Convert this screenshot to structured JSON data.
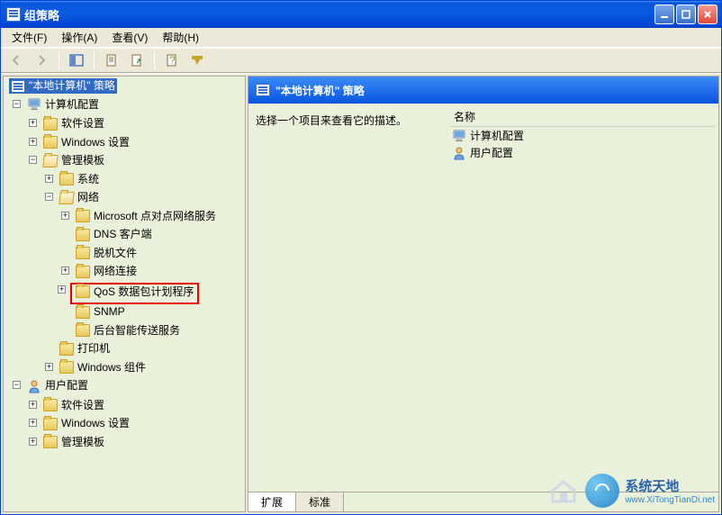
{
  "window": {
    "title": "组策略"
  },
  "menu": {
    "file": "文件(F)",
    "action": "操作(A)",
    "view": "查看(V)",
    "help": "帮助(H)"
  },
  "tree": {
    "root": "\"本地计算机\" 策略",
    "computer_config": "计算机配置",
    "software_settings": "软件设置",
    "windows_settings": "Windows 设置",
    "admin_templates": "管理模板",
    "system": "系统",
    "network": "网络",
    "ms_p2p": "Microsoft 点对点网络服务",
    "dns_client": "DNS 客户端",
    "offline_files": "脱机文件",
    "network_connections": "网络连接",
    "qos": "QoS 数据包计划程序",
    "snmp": "SNMP",
    "bits": "后台智能传送服务",
    "printers": "打印机",
    "windows_components": "Windows 组件",
    "user_config": "用户配置",
    "user_software": "软件设置",
    "user_windows": "Windows 设置",
    "user_admin": "管理模板"
  },
  "right": {
    "header": "\"本地计算机\" 策略",
    "description": "选择一个项目来查看它的描述。",
    "column_name": "名称",
    "items": {
      "computer": "计算机配置",
      "user": "用户配置"
    }
  },
  "tabs": {
    "extended": "扩展",
    "standard": "标准"
  },
  "watermark": {
    "brand": "系统天地",
    "url": "www.XiTongTianDi.net"
  }
}
